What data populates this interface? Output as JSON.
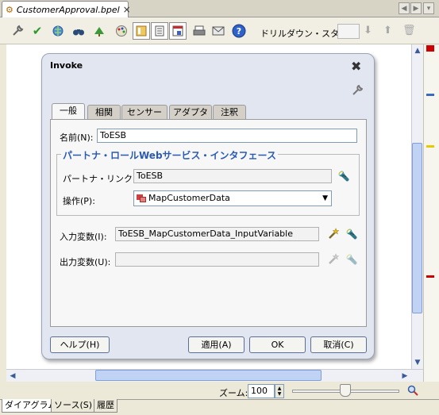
{
  "document_tab": {
    "title": "CustomerApproval.bpel",
    "close": "×"
  },
  "toolbar": {
    "drill_label": "ドリルダウン・スタック:",
    "buttons": [
      "wrench-icon",
      "validate-check-icon",
      "globe-icon",
      "binoculars-icon",
      "tree-icon",
      "palette-icon",
      "panel-icon",
      "document-icon",
      "print-icon",
      "email-icon",
      "help-icon"
    ],
    "help_glyph": "?"
  },
  "dialog": {
    "title": "Invoke",
    "tabs": [
      "一般",
      "相関",
      "センサー",
      "アダプタ",
      "注釈"
    ],
    "name_label": "名前(N):",
    "name_value": "ToESB",
    "group_title": "パートナ・ロールWebサービス・インタフェース",
    "partner_link_label": "パートナ・リンク(L):",
    "partner_link_value": "ToESB",
    "operation_label": "操作(P):",
    "operation_value": "MapCustomerData",
    "input_var_label": "入力変数(I):",
    "input_var_value": "ToESB_MapCustomerData_InputVariable",
    "output_var_label": "出力変数(U):",
    "output_var_value": "",
    "buttons": {
      "help": "ヘルプ(H)",
      "apply": "適用(A)",
      "ok": "OK",
      "cancel": "取消(C)"
    }
  },
  "zoom": {
    "label": "ズーム:",
    "value": "100"
  },
  "bottom_tabs": [
    "ダイアグラム",
    "ソース(S)",
    "履歴"
  ],
  "colors": {
    "accent_blue": "#2a5bb0",
    "overview_red": "#cc0000",
    "overview_yellow": "#e8c800",
    "overview_blue": "#3a6ac8"
  }
}
